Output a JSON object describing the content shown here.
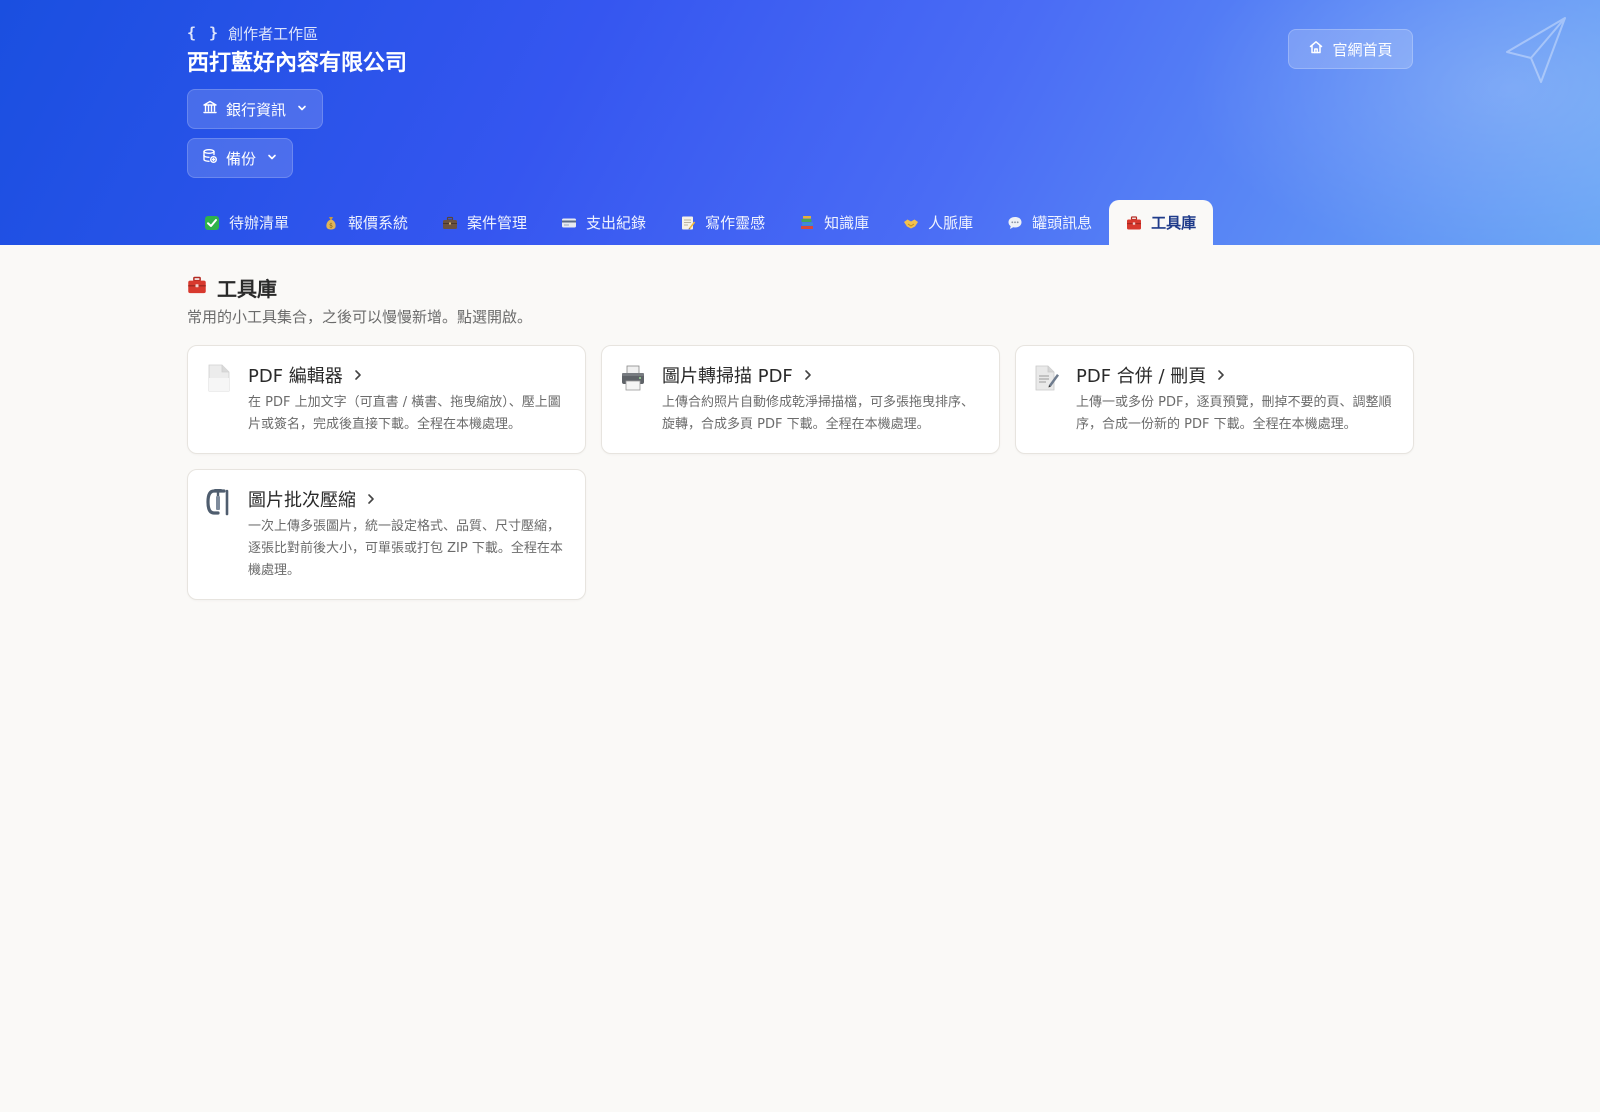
{
  "header": {
    "kicker_icon": "{ }",
    "kicker": "創作者工作區",
    "company": "西打藍好內容有限公司",
    "bank_button": "銀行資訊",
    "backup_button": "備份",
    "home_button": "官網首頁"
  },
  "tabs": [
    {
      "label": "待辦清單",
      "icon": "check-box-icon"
    },
    {
      "label": "報價系統",
      "icon": "money-bag-icon"
    },
    {
      "label": "案件管理",
      "icon": "briefcase-icon"
    },
    {
      "label": "支出紀錄",
      "icon": "credit-card-icon"
    },
    {
      "label": "寫作靈感",
      "icon": "memo-icon"
    },
    {
      "label": "知識庫",
      "icon": "books-icon"
    },
    {
      "label": "人脈庫",
      "icon": "handshake-icon"
    },
    {
      "label": "罐頭訊息",
      "icon": "speech-bubble-icon"
    },
    {
      "label": "工具庫",
      "icon": "toolbox-icon",
      "active": true
    }
  ],
  "main": {
    "title": "工具庫",
    "subtitle": "常用的小工具集合，之後可以慢慢新增。點選開啟。",
    "cards": [
      {
        "title": "PDF 編輯器",
        "icon": "document-icon",
        "desc": "在 PDF 上加文字（可直書 / 橫書、拖曳縮放）、壓上圖片或簽名，完成後直接下載。全程在本機處理。"
      },
      {
        "title": "圖片轉掃描 PDF",
        "icon": "printer-icon",
        "desc": "上傳合約照片自動修成乾淨掃描檔，可多張拖曳排序、旋轉，合成多頁 PDF 下載。全程在本機處理。"
      },
      {
        "title": "PDF 合併 / 刪頁",
        "icon": "document-pen-icon",
        "desc": "上傳一或多份 PDF，逐頁預覽，刪掉不要的頁、調整順序，合成一份新的 PDF 下載。全程在本機處理。"
      },
      {
        "title": "圖片批次壓縮",
        "icon": "clamp-icon",
        "desc": "一次上傳多張圖片，統一設定格式、品質、尺寸壓縮，逐張比對前後大小，可單張或打包 ZIP 下載。全程在本機處理。"
      }
    ]
  }
}
